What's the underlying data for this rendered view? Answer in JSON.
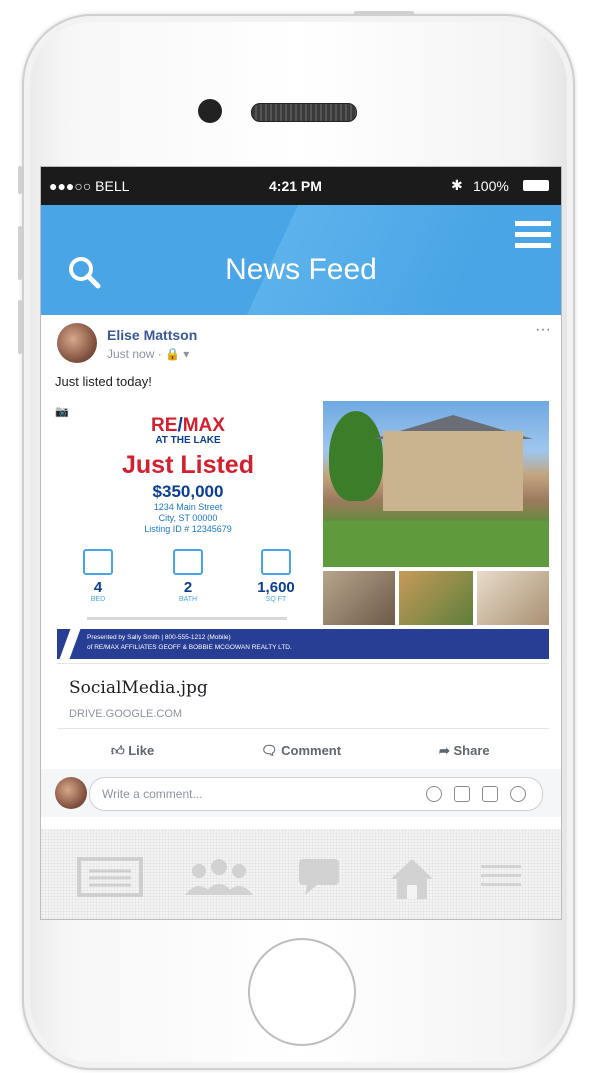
{
  "status_bar": {
    "carrier": "●●●○○ BELL",
    "time": "4:21 PM",
    "battery": "100%"
  },
  "nav": {
    "title": "News Feed"
  },
  "post": {
    "author": "Elise Mattson",
    "meta": "Just now · 🔒 ▾",
    "more": "···",
    "text": "Just listed today!",
    "ad": {
      "brand_top": "RE",
      "brand_slash": "/",
      "brand_rest": "MAX",
      "brand_sub": "AT THE LAKE",
      "headline": "Just Listed",
      "price": "$350,000",
      "address_line1": "1234 Main Street",
      "address_line2": "City, ST 00000",
      "listing_id": "Listing ID # 12345679",
      "stats": [
        {
          "value": "4",
          "label": "BED"
        },
        {
          "value": "2",
          "label": "BATH"
        },
        {
          "value": "1,600",
          "label": "SQ FT"
        }
      ],
      "presented_line1": "Presented by Sally Smith | 800-555-1212 (Mobile)",
      "presented_line2": "of RE/MAX AFFILIATES GEOFF & BOBBIE MCGOWAN REALTY LTD."
    },
    "link": {
      "title": "SocialMedia.jpg",
      "domain": "DRIVE.GOOGLE.COM"
    },
    "actions": {
      "like": "Like",
      "comment": "Comment",
      "share": "Share"
    },
    "comment_placeholder": "Write a comment..."
  },
  "colors": {
    "nav_blue": "#4aa5e6",
    "link_blue": "#3b5998",
    "remax_red": "#d3202f",
    "remax_navy": "#0b3d91"
  }
}
